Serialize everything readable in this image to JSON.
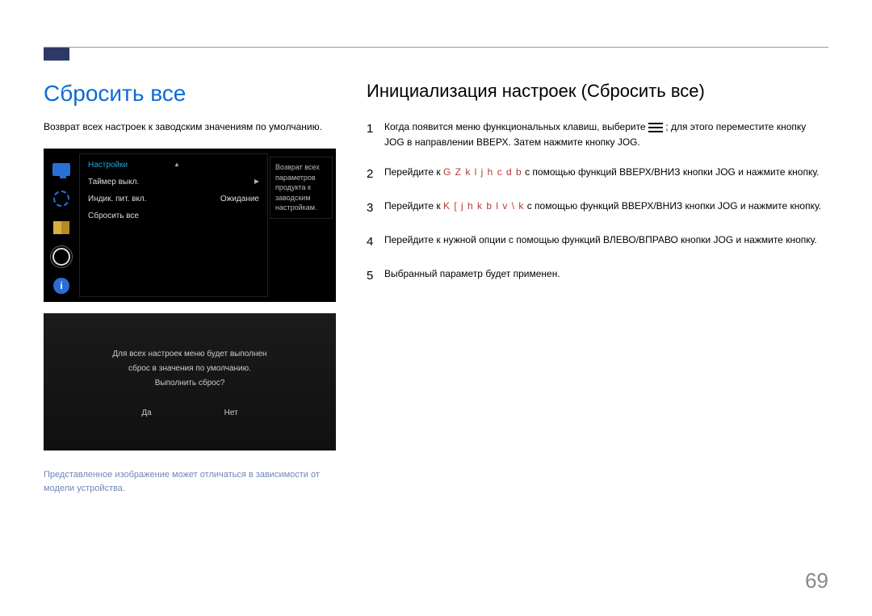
{
  "left": {
    "heading": "Сбросить все",
    "intro": "Возврат всех настроек к заводским значениям по умолчанию.",
    "osd1": {
      "title": "Настройки",
      "rows": [
        {
          "label": "Таймер выкл."
        },
        {
          "label": "Индик. пит. вкл.",
          "value": "Ожидание"
        },
        {
          "label": "Сбросить все"
        }
      ],
      "tooltip": "Возврат всех параметров продукта к заводским настройкам."
    },
    "osd2": {
      "line1": "Для всех настроек меню будет выполнен",
      "line2": "сброс в значения по умолчанию.",
      "line3": "Выполнить сброс?",
      "yes": "Да",
      "no": "Нет"
    },
    "footnote": "Представленное изображение может отличаться в зависимости от модели устройства."
  },
  "right": {
    "heading": "Инициализация настроек (Сбросить все)",
    "steps": [
      {
        "n": "1",
        "pre": "Когда появится меню функциональных клавиш, выберите ",
        "icon": "menu",
        "post": " ; для этого переместите кнопку JOG в направлении ВВЕРХ. Затем нажмите кнопку JOG."
      },
      {
        "n": "2",
        "pre": "Перейдите к ",
        "accent": "G Z k l j h c d b",
        "post": " с помощью функций ВВЕРХ/ВНИЗ кнопки JOG и нажмите кнопку."
      },
      {
        "n": "3",
        "pre": "Перейдите к ",
        "accent": "K [ j h k b l v   \\ k",
        "post": " с помощью функций ВВЕРХ/ВНИЗ кнопки JOG и нажмите кнопку."
      },
      {
        "n": "4",
        "text": "Перейдите к нужной опции с помощью функций ВЛЕВО/ВПРАВО кнопки JOG и нажмите кнопку."
      },
      {
        "n": "5",
        "text": "Выбранный параметр будет применен."
      }
    ]
  },
  "pageNumber": "69"
}
